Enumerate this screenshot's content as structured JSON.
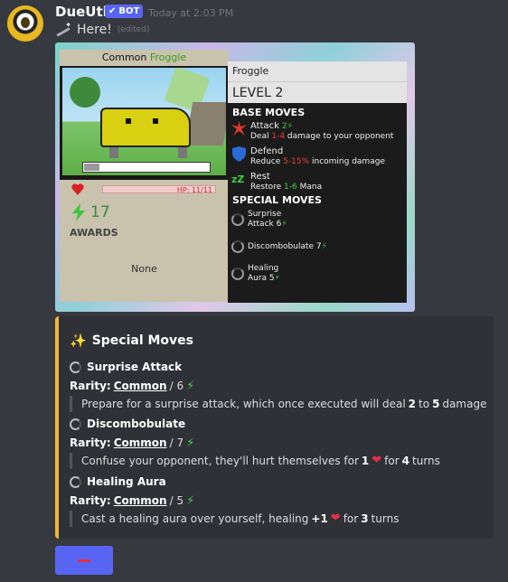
{
  "message": {
    "username": "DueUtil",
    "bot_tag": "BOT",
    "timestamp": "Today at 2:03 PM",
    "text": "Here!",
    "edited": "(edited)"
  },
  "card": {
    "rarity": "Common",
    "creature": "Froggle",
    "name": "Froggle",
    "level": "LEVEL 2",
    "hp": "HP: 11/11",
    "awards_count": "17",
    "awards_label": "AWARDS",
    "awards_none": "None",
    "xp_progress": 0.12,
    "base_moves_header": "BASE MOVES",
    "special_moves_header": "SPECIAL MOVES",
    "base_moves": [
      {
        "name": "Attack",
        "cost": "2",
        "desc_pre": "Deal ",
        "desc_highlight": "1-4",
        "desc_post": " damage to your opponent",
        "highlight_color": "#e84040"
      },
      {
        "name": "Defend",
        "cost": "",
        "desc_pre": "Reduce ",
        "desc_highlight": "5-15%",
        "desc_post": " incoming damage",
        "highlight_color": "#e84040"
      },
      {
        "name": "Rest",
        "cost": "",
        "desc_pre": "Restore ",
        "desc_highlight": "1-6",
        "desc_post": " Mana",
        "highlight_color": "#3fd03f"
      }
    ],
    "special_moves": [
      {
        "line1": "Surprise",
        "line2": "Attack 6"
      },
      {
        "line1": "Discombobulate 7",
        "line2": ""
      },
      {
        "line1": "Healing",
        "line2": "Aura 5"
      }
    ]
  },
  "embed": {
    "title": "Special Moves",
    "accent_color": "#f3b53a",
    "rarity_label": "Rarity:",
    "fields": [
      {
        "name": "Surprise Attack",
        "rarity": "Common",
        "cost": "/ 6",
        "desc": [
          "Prepare for a surprise attack, which once executed will deal ",
          "2",
          " to ",
          "5",
          " damage"
        ]
      },
      {
        "name": "Discombobulate",
        "rarity": "Common",
        "cost": "/ 7",
        "desc": [
          "Confuse your opponent, they'll hurt themselves for ",
          "1",
          " for ",
          "4",
          " turns"
        ]
      },
      {
        "name": "Healing Aura",
        "rarity": "Common",
        "cost": "/ 5",
        "desc": [
          "Cast a healing aura over yourself, healing ",
          "+1",
          " for ",
          "3",
          " turns"
        ]
      }
    ]
  },
  "button": {
    "icon": "minus-icon",
    "color": "#5865f2"
  }
}
